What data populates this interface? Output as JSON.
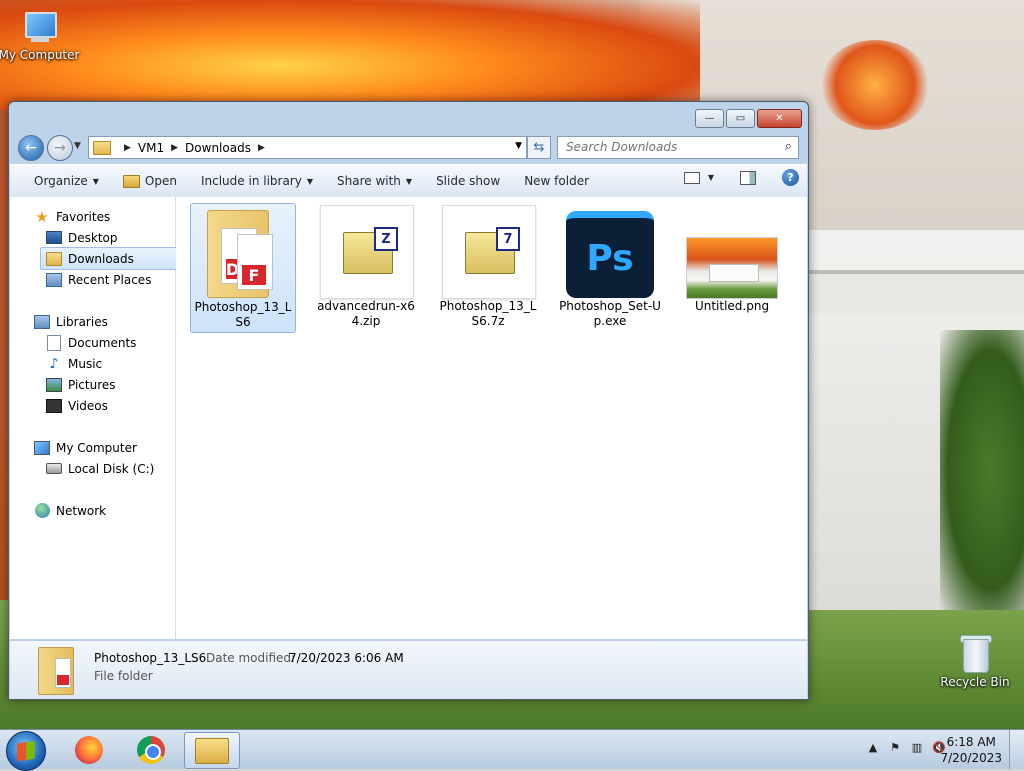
{
  "desktop": {
    "icons": [
      {
        "label": "My Computer",
        "icon": "computer-icon"
      },
      {
        "label": "Recycle Bin",
        "icon": "recycle-bin-icon"
      }
    ]
  },
  "window": {
    "caption_buttons": {
      "minimize": "—",
      "maximize": "▭",
      "close": "✕"
    },
    "breadcrumb": [
      "VM1",
      "Downloads"
    ],
    "search_placeholder": "Search Downloads",
    "toolbar": {
      "organize": "Organize",
      "open": "Open",
      "include_in_library": "Include in library",
      "share_with": "Share with",
      "slide_show": "Slide show",
      "new_folder": "New folder"
    },
    "nav": {
      "favorites": "Favorites",
      "desktop": "Desktop",
      "downloads": "Downloads",
      "recent_places": "Recent Places",
      "libraries": "Libraries",
      "documents": "Documents",
      "music": "Music",
      "pictures": "Pictures",
      "videos": "Videos",
      "my_computer": "My Computer",
      "local_disk": "Local Disk (C:)",
      "network": "Network"
    },
    "files": [
      {
        "name": "Photoshop_13_LS6",
        "type": "folder",
        "selected": true
      },
      {
        "name": "advancedrun-x64.zip",
        "type": "zip"
      },
      {
        "name": "Photoshop_13_LS6.7z",
        "type": "7z"
      },
      {
        "name": "Photoshop_Set-Up.exe",
        "type": "photoshop-exe",
        "icon_text": "Ps"
      },
      {
        "name": "Untitled.png",
        "type": "png"
      }
    ],
    "details": {
      "name": "Photoshop_13_LS6",
      "date_label": "Date modified:",
      "date_value": "7/20/2023 6:06 AM",
      "type": "File folder"
    }
  },
  "taskbar": {
    "apps": [
      "firefox-icon",
      "chrome-icon",
      "explorer-icon"
    ],
    "time": "6:18 AM",
    "date": "7/20/2023"
  }
}
